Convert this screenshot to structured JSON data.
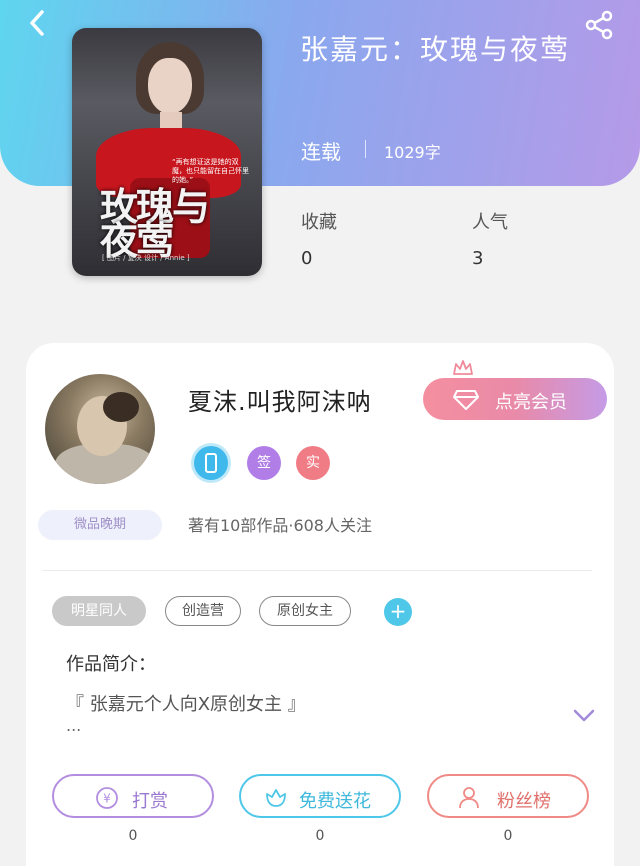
{
  "book": {
    "title": "张嘉元：玫瑰与夜莺",
    "status": "连载",
    "word_count": "1029字",
    "cover": {
      "title_art": "玫瑰与夜莺",
      "blurb": "“再有想证这是她的双魔，也只能留在自己怀里的她。”",
      "credit": "[ 图片 / 复决 设计 / Annie ]"
    }
  },
  "stats": {
    "favorites_label": "收藏",
    "favorites_value": "0",
    "popularity_label": "人气",
    "popularity_value": "3"
  },
  "author": {
    "name": "夏沫.叫我阿沫呐",
    "vip_button": "点亮会员",
    "level_tag": "微品晚期",
    "meta": "著有10部作品·608人关注",
    "badges": [
      {
        "icon": "phone-icon",
        "text": "",
        "color": "#3fb8ec"
      },
      {
        "icon": "sign-icon",
        "text": "签",
        "color": "#b07ee6"
      },
      {
        "icon": "real-icon",
        "text": "实",
        "color": "#f07c86"
      }
    ]
  },
  "tags": [
    "明星同人",
    "创造营",
    "原创女主"
  ],
  "intro": {
    "title": "作品简介：",
    "text": "『 张嘉元个人向X原创女主 』",
    "more": "..."
  },
  "actions": [
    {
      "label": "打赏",
      "icon": "yen-icon",
      "count": "0",
      "color": "#b28de0"
    },
    {
      "label": "免费送花",
      "icon": "flower-icon",
      "count": "0",
      "color": "#4fc7e8"
    },
    {
      "label": "粉丝榜",
      "icon": "user-icon",
      "count": "0",
      "color": "#f08a86"
    }
  ]
}
